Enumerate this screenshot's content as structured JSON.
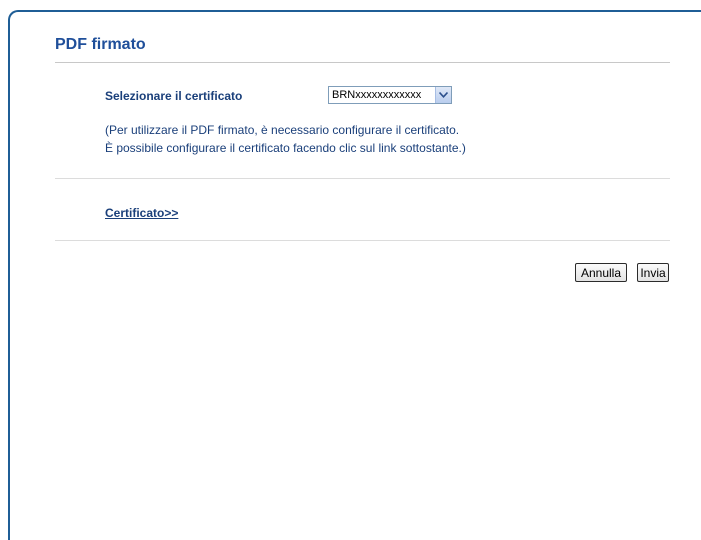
{
  "page": {
    "title": "PDF firmato"
  },
  "certificate": {
    "label": "Selezionare il certificato",
    "selected_value": "BRNxxxxxxxxxxxx",
    "dropdown_icon": "chevron-down-icon"
  },
  "help": {
    "line1": "(Per utilizzare il PDF firmato, è necessario configurare il certificato.",
    "line2": "È possibile configurare il certificato facendo clic sul link sottostante.)"
  },
  "links": {
    "certificate_link": "Certificato>>"
  },
  "buttons": {
    "cancel_label": "Annulla",
    "submit_label": "Invia"
  },
  "colors": {
    "accent": "#1f4f9a",
    "frame_border": "#1f5e96",
    "text": "#1a3f7a"
  }
}
